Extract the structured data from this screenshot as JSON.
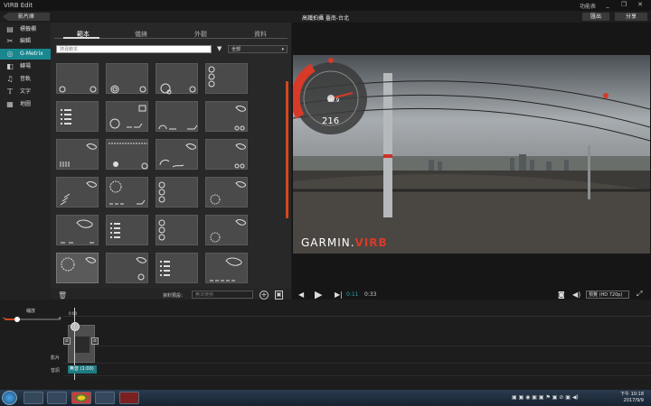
{
  "window": {
    "title": "VIRB Edit",
    "menu_label": "功能表",
    "min": "_",
    "restore": "❐",
    "close": "✕"
  },
  "toolbar": {
    "back_label": "影片庫",
    "project_title": "高鐵拍攝 臺南-台北",
    "export_label": "匯出",
    "share_label": "分享"
  },
  "sidebar": {
    "items": [
      {
        "label": "標籤欄",
        "icon": "film-strip-icon"
      },
      {
        "label": "編輯",
        "icon": "scissors-icon"
      },
      {
        "label": "G-Metrix",
        "icon": "gmetrix-icon",
        "active": true
      },
      {
        "label": "轉場",
        "icon": "transition-icon"
      },
      {
        "label": "音軌",
        "icon": "music-note-icon"
      },
      {
        "label": "文字",
        "icon": "text-icon"
      },
      {
        "label": "地圖",
        "icon": "map-icon"
      }
    ]
  },
  "panel": {
    "tabs": [
      {
        "label": "範本",
        "active": true
      },
      {
        "label": "儀錶"
      },
      {
        "label": "外觀"
      },
      {
        "label": "資料"
      }
    ],
    "search_placeholder": "搜尋範本",
    "filter_value": "全部",
    "data_source_label": "資料預設：",
    "data_source_value": "無法使用"
  },
  "player": {
    "current_time": "0:11",
    "total_time": "0:33",
    "play_tooltip": "播放",
    "quality": "預覽 (HD 720p)",
    "brand_text": "GARMIN.",
    "brand_text_2": "VIRB",
    "gauge_speed": "216",
    "gauge_small": "90.9"
  },
  "timeline": {
    "zoom_label": "縮放",
    "ruler_start": "0:00",
    "track_video": "影片",
    "track_audio": "音訊",
    "audio_clip_label": "無音 (1:00)"
  },
  "taskbar": {
    "time": "下午 10:18",
    "date": "2017/9/9"
  },
  "colors": {
    "accent": "#19878f",
    "orange": "#d4471f",
    "gauge_red": "#d73a28"
  }
}
